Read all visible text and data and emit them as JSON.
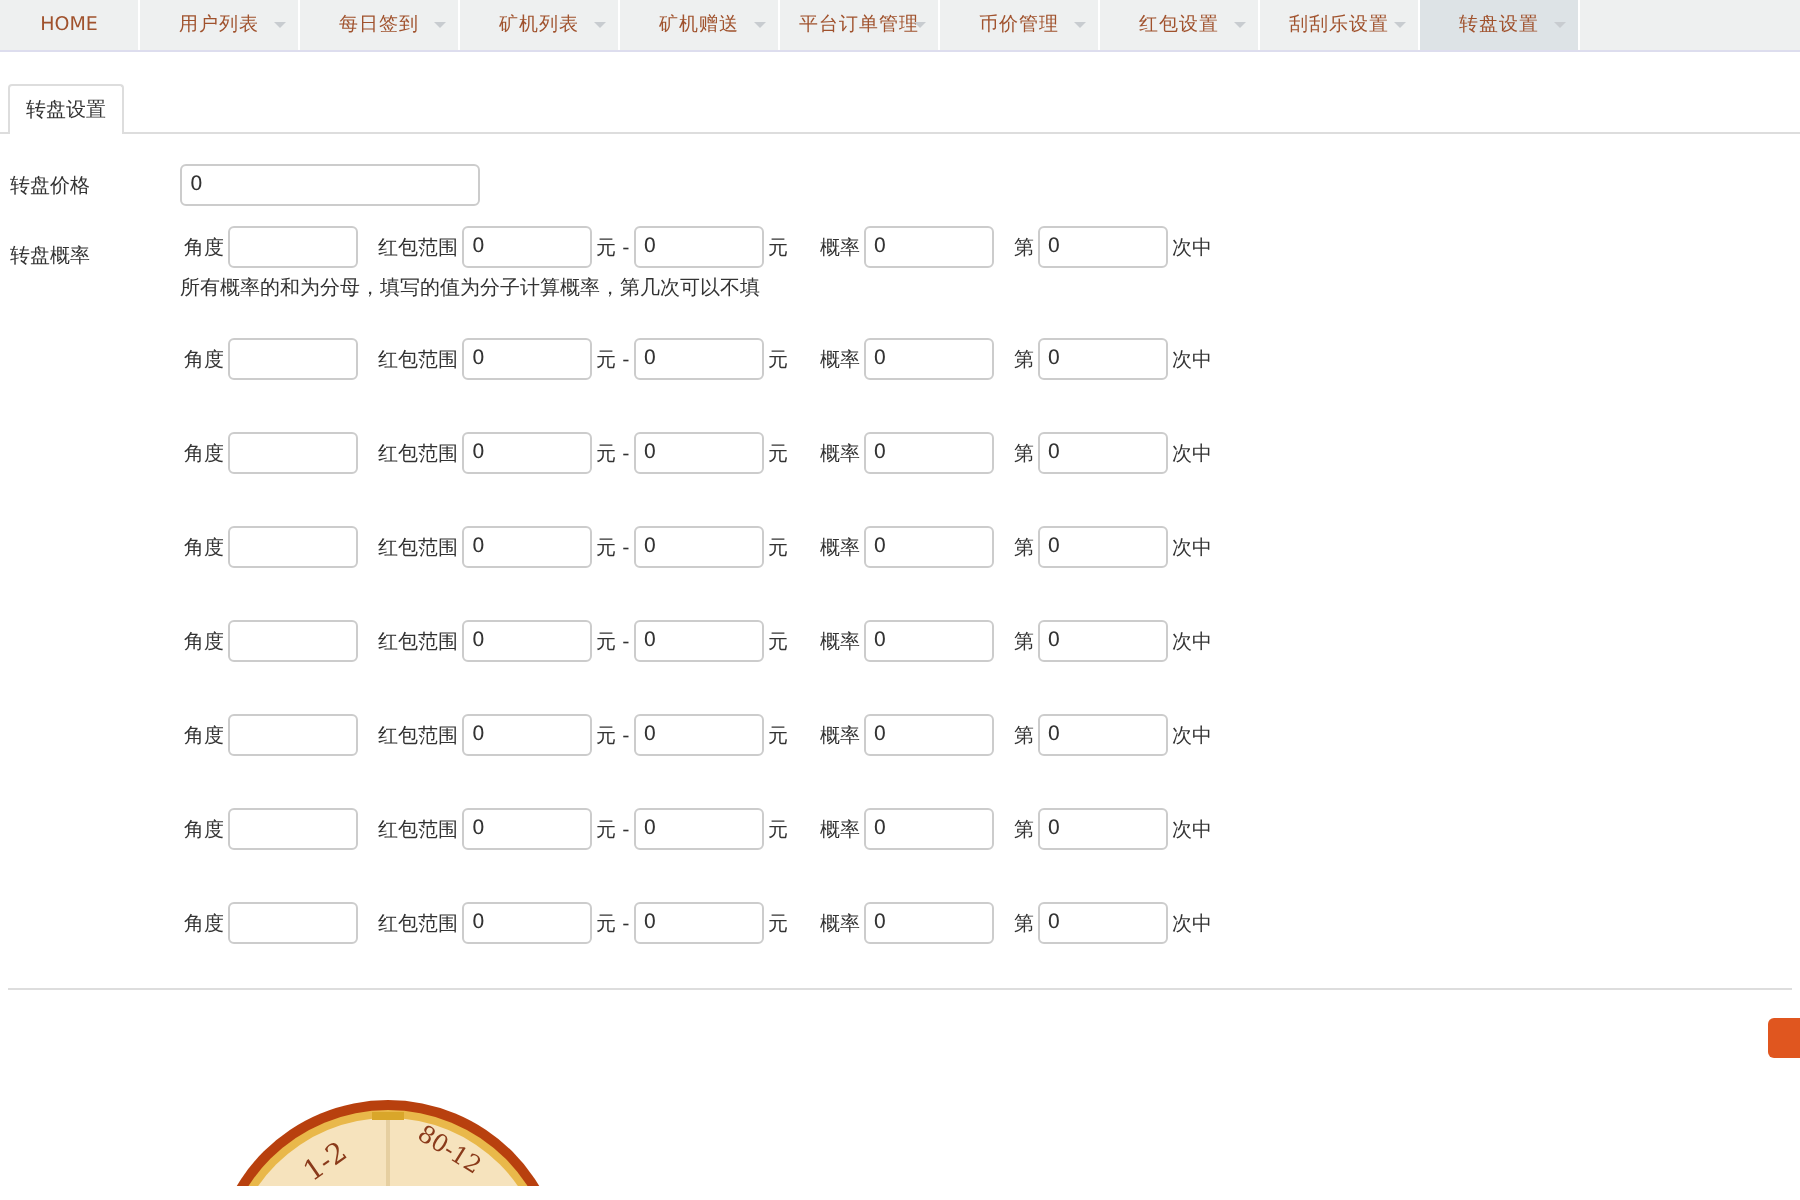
{
  "nav": [
    {
      "label": "HOME",
      "caret": false,
      "selected": false
    },
    {
      "label": "用户列表",
      "caret": true,
      "selected": false
    },
    {
      "label": "每日签到",
      "caret": true,
      "selected": false
    },
    {
      "label": "矿机列表",
      "caret": true,
      "selected": false
    },
    {
      "label": "矿机赠送",
      "caret": true,
      "selected": false
    },
    {
      "label": "平台订单管理",
      "caret": true,
      "selected": false
    },
    {
      "label": "币价管理",
      "caret": true,
      "selected": false
    },
    {
      "label": "红包设置",
      "caret": true,
      "selected": false
    },
    {
      "label": "刮刮乐设置",
      "caret": true,
      "selected": false
    },
    {
      "label": "转盘设置",
      "caret": true,
      "selected": true
    }
  ],
  "tabs": [
    {
      "label": "转盘设置",
      "selected": true
    }
  ],
  "price": {
    "label": "转盘价格",
    "value": "0"
  },
  "probability": {
    "label": "转盘概率",
    "note": "所有概率的和为分母，填写的值为分子计算概率，第几次可以不填",
    "rows": [
      {
        "angle_label": "角度",
        "range_label": "红包范围",
        "min": "0",
        "sep": "元 -",
        "max": "0",
        "unit": "元",
        "prob_label": "概率",
        "prob": "0",
        "nth_label": "第",
        "nth": "0",
        "nth_suffix": "次中"
      },
      {
        "angle_label": "角度",
        "range_label": "红包范围",
        "min": "0",
        "sep": "元 -",
        "max": "0",
        "unit": "元",
        "prob_label": "概率",
        "prob": "0",
        "nth_label": "第",
        "nth": "0",
        "nth_suffix": "次中"
      },
      {
        "angle_label": "角度",
        "range_label": "红包范围",
        "min": "0",
        "sep": "元 -",
        "max": "0",
        "unit": "元",
        "prob_label": "概率",
        "prob": "0",
        "nth_label": "第",
        "nth": "0",
        "nth_suffix": "次中"
      },
      {
        "angle_label": "角度",
        "range_label": "红包范围",
        "min": "0",
        "sep": "元 -",
        "max": "0",
        "unit": "元",
        "prob_label": "概率",
        "prob": "0",
        "nth_label": "第",
        "nth": "0",
        "nth_suffix": "次中"
      },
      {
        "angle_label": "角度",
        "range_label": "红包范围",
        "min": "0",
        "sep": "元 -",
        "max": "0",
        "unit": "元",
        "prob_label": "概率",
        "prob": "0",
        "nth_label": "第",
        "nth": "0",
        "nth_suffix": "次中"
      },
      {
        "angle_label": "角度",
        "range_label": "红包范围",
        "min": "0",
        "sep": "元 -",
        "max": "0",
        "unit": "元",
        "prob_label": "概率",
        "prob": "0",
        "nth_label": "第",
        "nth": "0",
        "nth_suffix": "次中"
      },
      {
        "angle_label": "角度",
        "range_label": "红包范围",
        "min": "0",
        "sep": "元 -",
        "max": "0",
        "unit": "元",
        "prob_label": "概率",
        "prob": "0",
        "nth_label": "第",
        "nth": "0",
        "nth_suffix": "次中"
      },
      {
        "angle_label": "角度",
        "range_label": "红包范围",
        "min": "0",
        "sep": "元 -",
        "max": "0",
        "unit": "元",
        "prob_label": "概率",
        "prob": "0",
        "nth_label": "第",
        "nth": "0",
        "nth_suffix": "次中"
      }
    ]
  },
  "wheel": {
    "labels": [
      "1-2",
      "80-12"
    ]
  }
}
